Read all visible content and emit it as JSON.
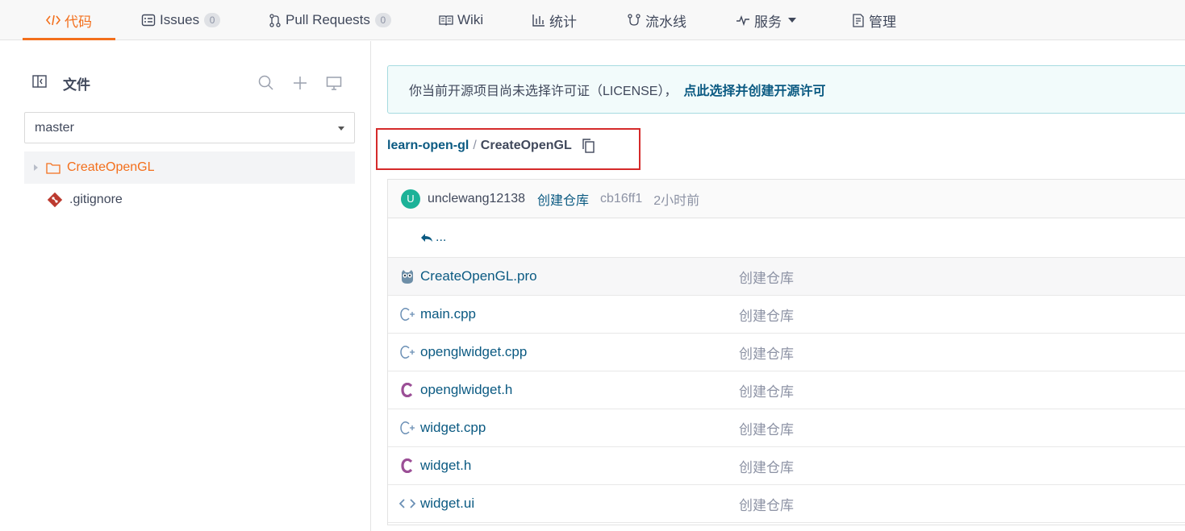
{
  "nav": {
    "tabs": [
      {
        "label": "代码",
        "icon": "code-icon",
        "active": true
      },
      {
        "label": "Issues",
        "icon": "issues-icon",
        "count": "0"
      },
      {
        "label": "Pull Requests",
        "icon": "pull-request-icon",
        "count": "0"
      },
      {
        "label": "Wiki",
        "icon": "wiki-icon"
      },
      {
        "label": "统计",
        "icon": "chart-icon"
      },
      {
        "label": "流水线",
        "icon": "pipeline-icon"
      },
      {
        "label": "服务",
        "icon": "pulse-icon",
        "dropdown": true
      },
      {
        "label": "管理",
        "icon": "manage-icon"
      }
    ]
  },
  "sidebar": {
    "title": "文件",
    "branch": "master",
    "tree": [
      {
        "name": "CreateOpenGL",
        "type": "folder",
        "selected": true
      },
      {
        "name": ".gitignore",
        "type": "file",
        "icon": "git-icon"
      }
    ]
  },
  "notice": {
    "text": "你当前开源项目尚未选择许可证（LICENSE），",
    "link": "点此选择并创建开源许可"
  },
  "breadcrumb": {
    "repo": "learn-open-gl",
    "separator": "/",
    "current": "CreateOpenGL"
  },
  "commit": {
    "avatar_letter": "U",
    "author": "unclewang12138",
    "message": "创建仓库",
    "hash": "cb16ff1",
    "time": "2小时前"
  },
  "parent_link": "...",
  "files": [
    {
      "name": "CreateOpenGL.pro",
      "icon": "owl-icon",
      "message": "创建仓库"
    },
    {
      "name": "main.cpp",
      "icon": "cpp-icon",
      "message": "创建仓库"
    },
    {
      "name": "openglwidget.cpp",
      "icon": "cpp-icon",
      "message": "创建仓库"
    },
    {
      "name": "openglwidget.h",
      "icon": "c-header-icon",
      "message": "创建仓库"
    },
    {
      "name": "widget.cpp",
      "icon": "cpp-icon",
      "message": "创建仓库"
    },
    {
      "name": "widget.h",
      "icon": "c-header-icon",
      "message": "创建仓库"
    },
    {
      "name": "widget.ui",
      "icon": "code-file-icon",
      "message": "创建仓库"
    }
  ],
  "colors": {
    "accent": "#f36f1c",
    "link": "#0b5a82",
    "highlight_border": "#d52a2a",
    "avatar": "#1cb298"
  }
}
